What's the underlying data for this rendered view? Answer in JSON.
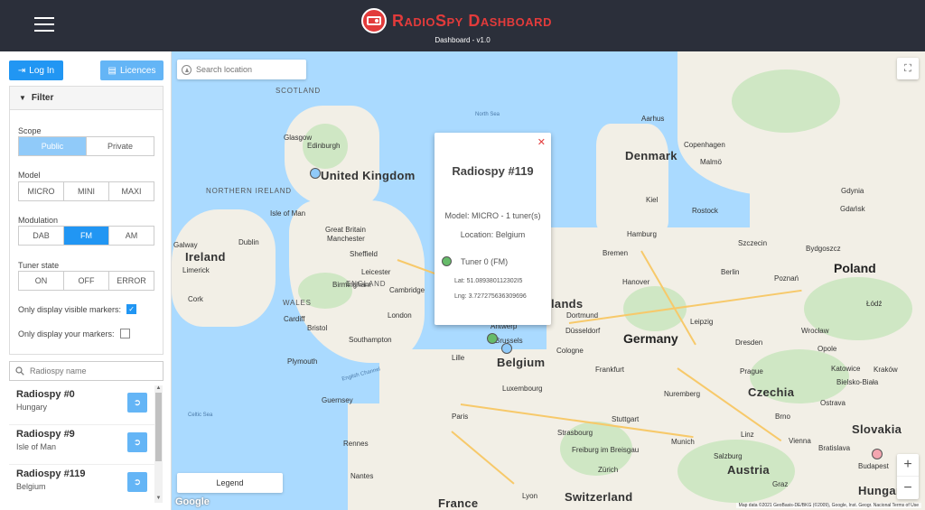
{
  "header": {
    "title": "RadioSpy Dashboard",
    "subtitle": "Dashboard - v1.0",
    "menu_icon": "hamburger-icon",
    "logo_icon": "radio-icon",
    "accent": "#e23b3b"
  },
  "sidebar": {
    "login_label": "Log In",
    "licences_label": "Licences",
    "filter": {
      "title": "Filter",
      "scope": {
        "label": "Scope",
        "options": [
          "Public",
          "Private"
        ],
        "selected": "Public"
      },
      "model": {
        "label": "Model",
        "options": [
          "MICRO",
          "MINI",
          "MAXI"
        ]
      },
      "modulation": {
        "label": "Modulation",
        "options": [
          "DAB",
          "FM",
          "AM"
        ],
        "selected": "FM"
      },
      "tuner_state": {
        "label": "Tuner state",
        "options": [
          "ON",
          "OFF",
          "ERROR"
        ]
      },
      "visible_markers_label": "Only display visible markers:",
      "visible_markers_checked": true,
      "your_markers_label": "Only display your markers:",
      "your_markers_checked": false
    },
    "search_placeholder": "Radiospy name",
    "items": [
      {
        "name": "Radiospy #0",
        "location": "Hungary"
      },
      {
        "name": "Radiospy #9",
        "location": "Isle of Man"
      },
      {
        "name": "Radiospy #119",
        "location": "Belgium"
      }
    ]
  },
  "map": {
    "search_placeholder": "Search location",
    "legend_label": "Legend",
    "google_label": "Google",
    "attribution": "Map data ©2021 GeoBasis-DE/BKG (©2009), Google, Inst. Geogr. Nacional   Terms of Use",
    "zoom_in": "+",
    "zoom_out": "−",
    "labels": {
      "scotland": "SCOTLAND",
      "north_sea": "North Sea",
      "glasgow": "Glasgow",
      "edinburgh": "Edinburgh",
      "uk": "United Kingdom",
      "northern_ireland": "NORTHERN IRELAND",
      "isle_of_man": "Isle of Man",
      "dublin": "Dublin",
      "ireland": "Ireland",
      "manchester": "Manchester",
      "sheffield": "Sheffield",
      "wales": "WALES",
      "england": "ENGLAND",
      "london": "London",
      "cambridge": "Cambridge",
      "plymouth": "Plymouth",
      "southampton": "Southampton",
      "english_channel": "English Channel",
      "celtic_sea": "Celtic Sea",
      "guernsey": "Guernsey",
      "rennes": "Rennes",
      "nantes": "Nantes",
      "paris": "Paris",
      "france": "France",
      "denmark": "Denmark",
      "copenhagen": "Copenhagen",
      "hamburg": "Hamburg",
      "bremen": "Bremen",
      "berlin": "Berlin",
      "hanover": "Hanover",
      "germany": "Germany",
      "leipzig": "Leipzig",
      "dortmund": "Dortmund",
      "dusseldorf": "Düsseldorf",
      "cologne": "Cologne",
      "frankfurt": "Frankfurt",
      "stuttgart": "Stuttgart",
      "munich": "Munich",
      "zurich": "Zürich",
      "switzerland": "Switzerland",
      "luxembourg": "Luxembourg",
      "strasbourg": "Strasbourg",
      "freiburg": "Freiburg im Breisgau",
      "antwerp": "Antwerp",
      "brussels": "Brussels",
      "belgium": "Belgium",
      "netherlands": "lands",
      "poland": "Poland",
      "gdansk": "Gdańsk",
      "gdynia": "Gdynia",
      "bydgoszcz": "Bydgoszcz",
      "szczecin": "Szczecin",
      "poznan": "Poznań",
      "lodz": "Łódź",
      "wroclaw": "Wrocław",
      "prague": "Prague",
      "czechia": "Czechia",
      "katowice": "Katowice",
      "krakow": "Kraków",
      "vienna": "Vienna",
      "bratislava": "Bratislava",
      "austria": "Austria",
      "slovakia": "Slovakia",
      "budapest": "Budapest",
      "hungary": "Hungary",
      "salzburg": "Salzburg",
      "nuremberg": "Nuremberg",
      "dresden": "Dresden",
      "bielsko": "Bielsko-Biała",
      "aarhus": "Aarhus",
      "malmo": "Malmö",
      "kiel": "Kiel",
      "rostock": "Rostock",
      "lille": "Lille",
      "lyon": "Lyon",
      "great_britain": "Great Britain",
      "limerick": "Limerick",
      "galway": "Galway",
      "cork": "Cork",
      "leicester": "Leicester",
      "birmingham": "Birmingham",
      "bristol": "Bristol",
      "cardiff": "Cardiff",
      "brno": "Brno",
      "opole": "Opole",
      "ostrava": "Ostrava",
      "linz": "Linz",
      "graz": "Graz"
    }
  },
  "popup": {
    "title": "Radiospy #119",
    "model": "Model: MICRO - 1 tuner(s)",
    "location": "Location: Belgium",
    "tuner": "Tuner 0 (FM)",
    "lat": "Lat: 51.089380112302I5",
    "lng": "Lng: 3.727275636309696"
  }
}
